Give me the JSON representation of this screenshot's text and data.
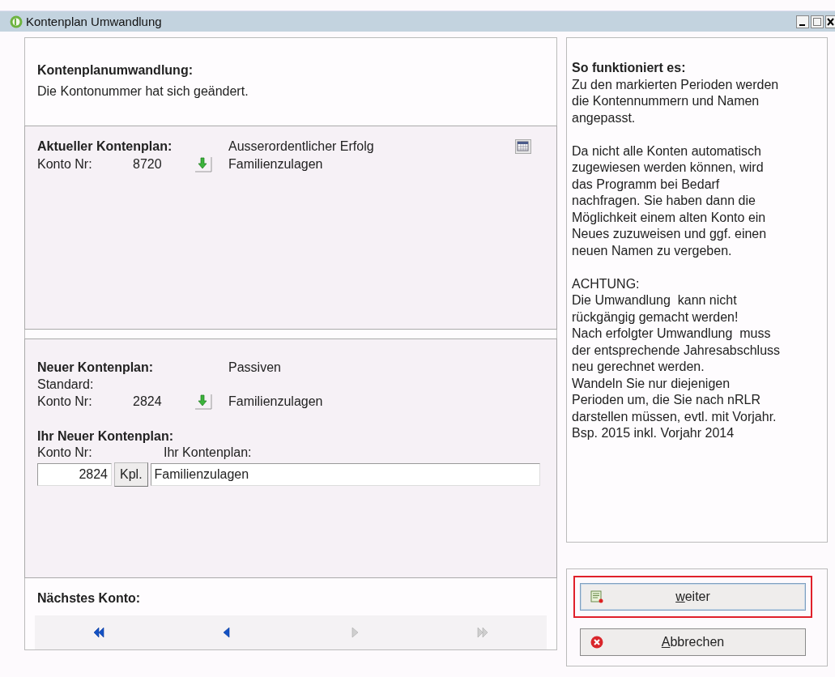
{
  "window": {
    "title": "Kontenplan Umwandlung"
  },
  "intro": {
    "heading": "Kontenplanumwandlung:",
    "text": "Die Kontonummer hat sich geändert."
  },
  "current": {
    "heading": "Aktueller Kontenplan:",
    "group": "Ausserordentlicher Erfolg",
    "konto_label": "Konto Nr:",
    "konto_nr": "8720",
    "name": "Familienzulagen"
  },
  "new": {
    "heading": "Neuer Kontenplan:",
    "group": "Passiven",
    "standard_label": "Standard:",
    "konto_label": "Konto Nr:",
    "konto_nr": "2824",
    "name": "Familienzulagen"
  },
  "yours": {
    "heading": "Ihr Neuer Kontenplan:",
    "konto_label": "Konto Nr:",
    "plan_label": "Ihr Kontenplan:",
    "konto_value": "2824",
    "kpl_button": "Kpl.",
    "name_value": "Familienzulagen"
  },
  "next": {
    "heading": "Nächstes Konto:",
    "nav": [
      {
        "kind": "first",
        "disabled": false
      },
      {
        "kind": "prev",
        "disabled": false
      },
      {
        "kind": "next",
        "disabled": true
      },
      {
        "kind": "last",
        "disabled": true
      }
    ]
  },
  "info": {
    "heading": "So funktioniert es:",
    "paragraphs": [
      "Zu den markierten Perioden werden\ndie Kontennummern und Namen\nangepasst.",
      "Da nicht alle Konten automatisch\nzugewiesen werden können, wird\ndas Programm bei Bedarf\nnachfragen. Sie haben dann die\nMöglichkeit einem alten Konto ein\nNeues zuzuweisen und ggf. einen\nneuen Namen zu vergeben.",
      "ACHTUNG:\nDie Umwandlung  kann nicht\nrückgängig gemacht werden!\nNach erfolgter Umwandlung  muss\nder entsprechende Jahresabschluss\nneu gerechnet werden.\nWandeln Sie nur diejenigen\nPerioden um, die Sie nach nRLR\ndarstellen müssen, evtl. mit Vorjahr.\nBsp. 2015 inkl. Vorjahr 2014"
    ]
  },
  "buttons": [
    {
      "kind": "next",
      "label": "weiter",
      "highlighted": true
    },
    {
      "kind": "cancel",
      "label": "Abbrechen",
      "highlighted": false
    }
  ]
}
